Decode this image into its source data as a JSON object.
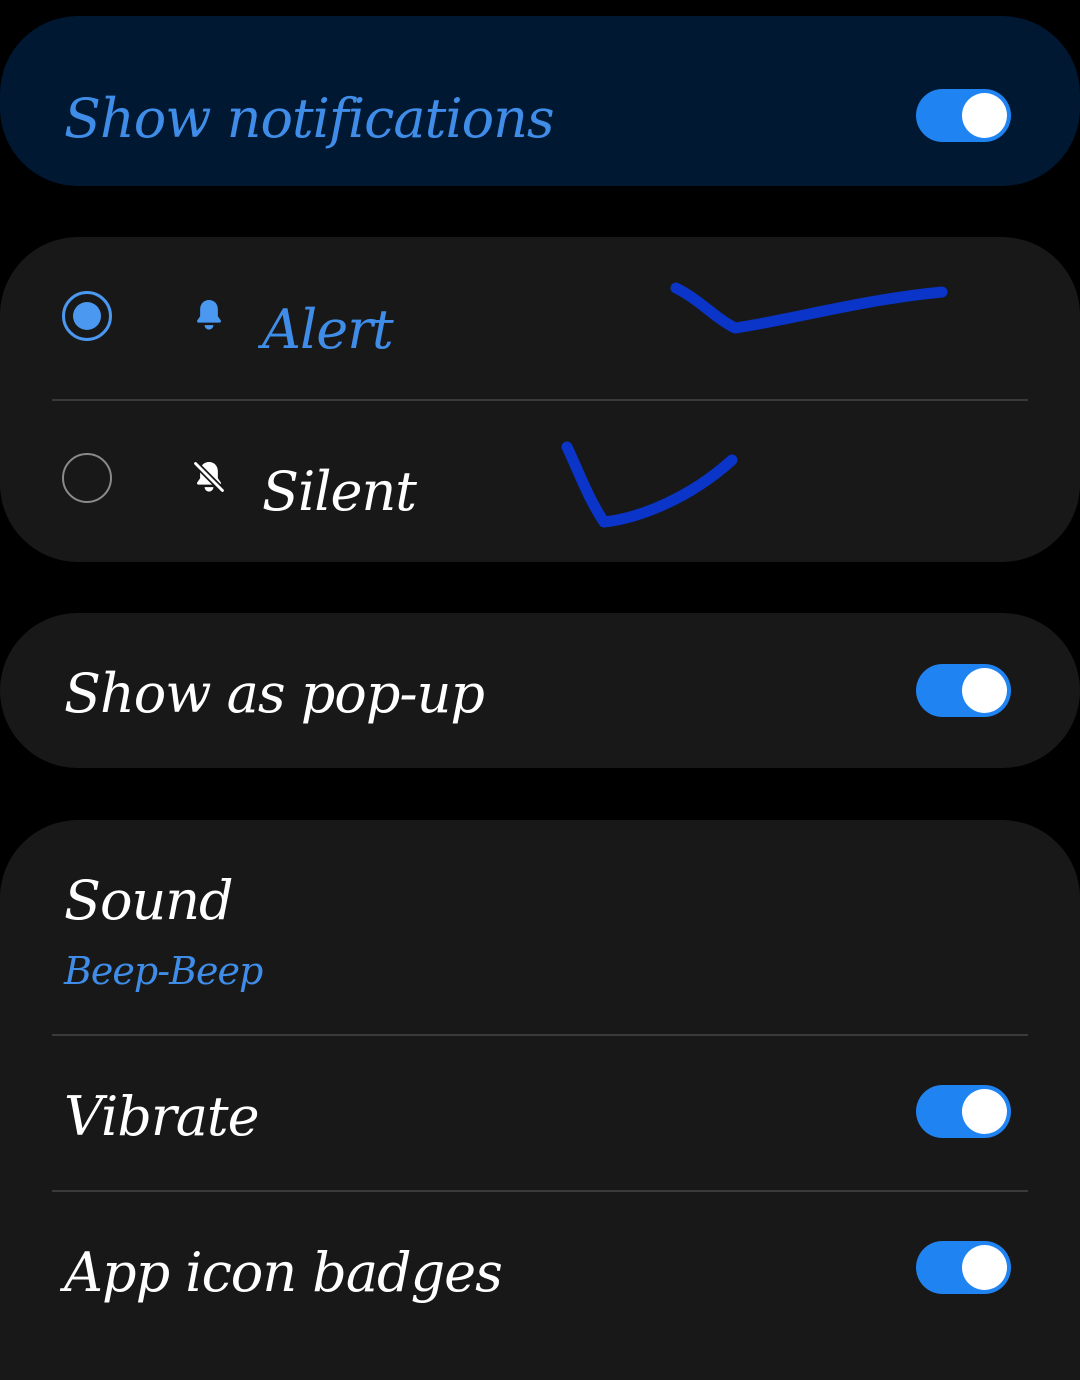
{
  "colors": {
    "accent": "#1f83f1",
    "accent_text": "#3f8de8",
    "card": "#181818",
    "card_highlight": "#001831",
    "ink": "#0a35c8"
  },
  "show_notifications": {
    "label": "Show notifications",
    "toggle_on": true
  },
  "notification_mode": {
    "options": [
      {
        "label": "Alert",
        "icon": "bell-icon",
        "selected": true
      },
      {
        "label": "Silent",
        "icon": "bell-off-icon",
        "selected": false
      }
    ]
  },
  "popup": {
    "label": "Show as pop-up",
    "toggle_on": true
  },
  "sound": {
    "label": "Sound",
    "value": "Beep-Beep"
  },
  "vibrate": {
    "label": "Vibrate",
    "toggle_on": true
  },
  "badges": {
    "label": "App icon badges",
    "toggle_on": true
  }
}
